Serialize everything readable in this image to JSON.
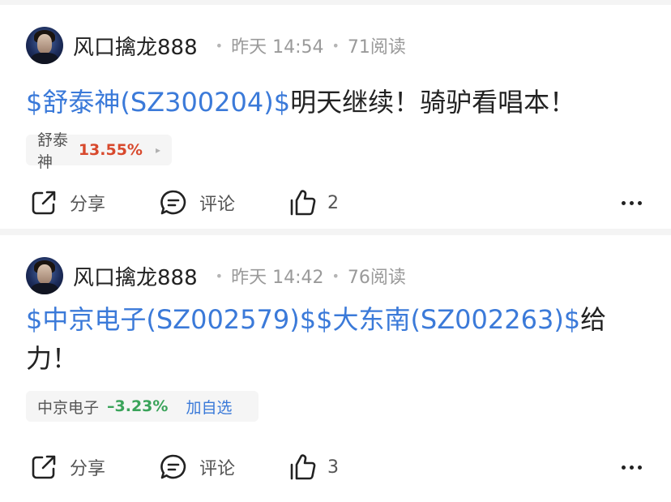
{
  "posts": [
    {
      "username": "风口擒龙888",
      "time": "昨天 14:54",
      "reads": "71阅读",
      "content_link": "$舒泰神(SZ300204)$",
      "content_text": "明天继续！骑驴看唱本！",
      "stock": {
        "name": "舒泰神",
        "change": "13.55%",
        "direction": "up",
        "extra": "▸"
      },
      "actions": {
        "share": "分享",
        "comment": "评论",
        "likes": "2"
      }
    },
    {
      "username": "风口擒龙888",
      "time": "昨天 14:42",
      "reads": "76阅读",
      "content_link": "$中京电子(SZ002579)$$大东南(SZ002263)$",
      "content_text": "给力！",
      "stock": {
        "name": "中京电子",
        "change": "–3.23%",
        "direction": "down",
        "extra": "加自选"
      },
      "actions": {
        "share": "分享",
        "comment": "评论",
        "likes": "3"
      }
    }
  ],
  "colors": {
    "link": "#3b7ad9",
    "up": "#d8492d",
    "down": "#3aa35a"
  },
  "icons": [
    "share-icon",
    "comment-icon",
    "thumbs-up-icon",
    "more-icon"
  ]
}
